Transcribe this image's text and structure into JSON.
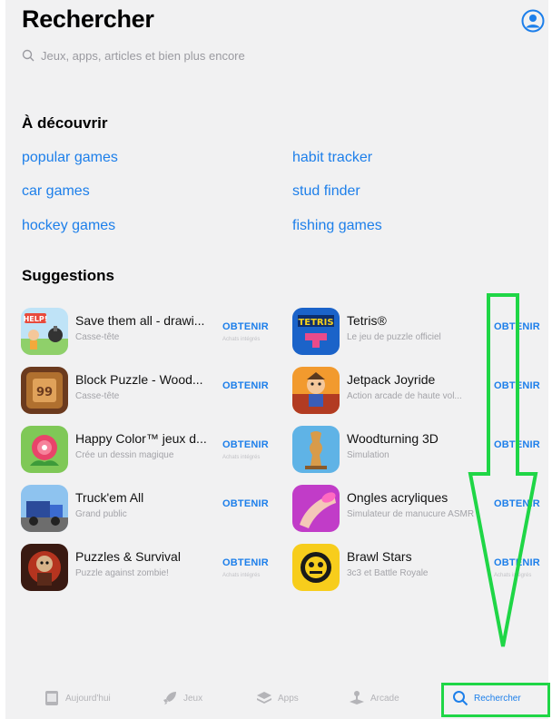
{
  "header": {
    "title": "Rechercher"
  },
  "search": {
    "placeholder": "Jeux, apps, articles et bien plus encore"
  },
  "discover": {
    "title": "À découvrir",
    "links": [
      "popular games",
      "habit tracker",
      "car games",
      "stud finder",
      "hockey games",
      "fishing games"
    ]
  },
  "suggestions": {
    "title": "Suggestions",
    "get_label": "OBTENIR",
    "in_app_label": "Achats intégrés",
    "apps": [
      {
        "name": "Save them all - drawi...",
        "sub": "Casse-tête",
        "icon": "save-them-all-icon"
      },
      {
        "name": "Tetris®",
        "sub": "Le jeu de puzzle officiel",
        "icon": "tetris-icon"
      },
      {
        "name": "Block Puzzle - Wood...",
        "sub": "Casse-tête",
        "icon": "block-puzzle-icon"
      },
      {
        "name": "Jetpack Joyride",
        "sub": "Action arcade de haute vol...",
        "icon": "jetpack-joyride-icon"
      },
      {
        "name": "Happy Color™ jeux d...",
        "sub": "Crée un dessin magique",
        "icon": "happy-color-icon"
      },
      {
        "name": "Woodturning 3D",
        "sub": "Simulation",
        "icon": "woodturning-icon"
      },
      {
        "name": "Truck'em All",
        "sub": "Grand public",
        "icon": "truck-em-all-icon"
      },
      {
        "name": "Ongles acryliques",
        "sub": "Simulateur de manucure ASMR",
        "icon": "acrylic-nails-icon"
      },
      {
        "name": "Puzzles & Survival",
        "sub": "Puzzle against zombie!",
        "icon": "puzzles-survival-icon"
      },
      {
        "name": "Brawl Stars",
        "sub": "3c3 et Battle Royale",
        "icon": "brawl-stars-icon"
      }
    ]
  },
  "tabs": [
    {
      "label": "Aujourd'hui",
      "icon": "today-icon"
    },
    {
      "label": "Jeux",
      "icon": "rocket-icon"
    },
    {
      "label": "Apps",
      "icon": "layers-icon"
    },
    {
      "label": "Arcade",
      "icon": "joystick-icon"
    },
    {
      "label": "Rechercher",
      "icon": "search-icon"
    }
  ],
  "colors": {
    "accent": "#1d7fea",
    "highlight": "#1fd646",
    "background": "#f1f1f2"
  }
}
